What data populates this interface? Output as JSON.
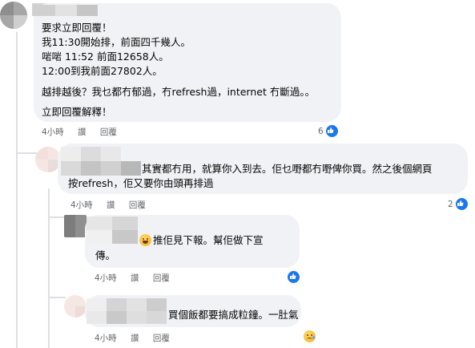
{
  "comments": [
    {
      "lines": [
        "要求立即回覆！",
        "我11:30開始排，前面四千幾人。",
        "啱啱 11:52 前面12658人。",
        "12:00到我前面27802人。",
        "越排越後？我乜都冇郁過，冇refresh過，internet 冇斷過。。",
        "立即回覆解釋！"
      ],
      "time": "4小時",
      "actions": [
        "讚",
        "回覆"
      ],
      "reaction_count": "6",
      "reaction": "like-icon"
    },
    {
      "lines": [
        "其實都冇用，就算你入到去。佢乜嘢都冇嘢俾你買。然之後個網頁",
        "按refresh，佢又要你由頭再排過"
      ],
      "time": "4小時",
      "actions": [
        "讚",
        "回覆"
      ],
      "reaction_count": "2",
      "reaction": "like-icon"
    },
    {
      "lines": [
        "推佢見下報。幫佢做下宣",
        "傳。"
      ],
      "leading_emoji": "grin-sweat-emoji",
      "time": "4小時",
      "actions": [
        "讚",
        "回覆"
      ],
      "reaction_count": "",
      "reaction": "like-icon"
    },
    {
      "lines": [
        "買個飯都要搞成粒鐘。一肚氣"
      ],
      "time": "4小時",
      "actions": [
        "讚",
        "回覆"
      ],
      "reaction_count": "",
      "reaction": "sad-emoji"
    }
  ],
  "colors": {
    "bubble": "#f0f2f5",
    "meta_text": "#65676b",
    "like_blue": "#1877f2",
    "thread_line": "#dddfe2"
  }
}
